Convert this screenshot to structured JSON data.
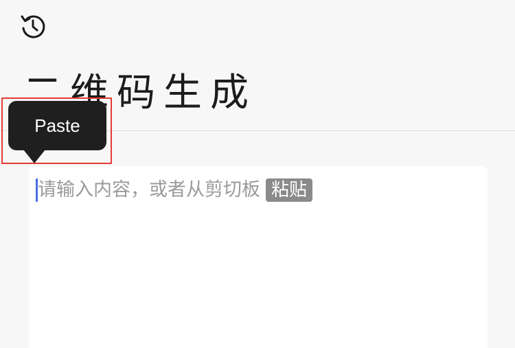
{
  "header": {
    "history_icon": "history-icon"
  },
  "page": {
    "title": "二维码生成"
  },
  "editor": {
    "placeholder": "请输入内容，或者从剪切板",
    "paste_link_label": "粘贴"
  },
  "context_menu": {
    "paste_label": "Paste"
  },
  "colors": {
    "background": "#f7f7f7",
    "caret": "#4a6ee0",
    "tooltip": "#1f1f1f",
    "highlight": "#e53935"
  }
}
